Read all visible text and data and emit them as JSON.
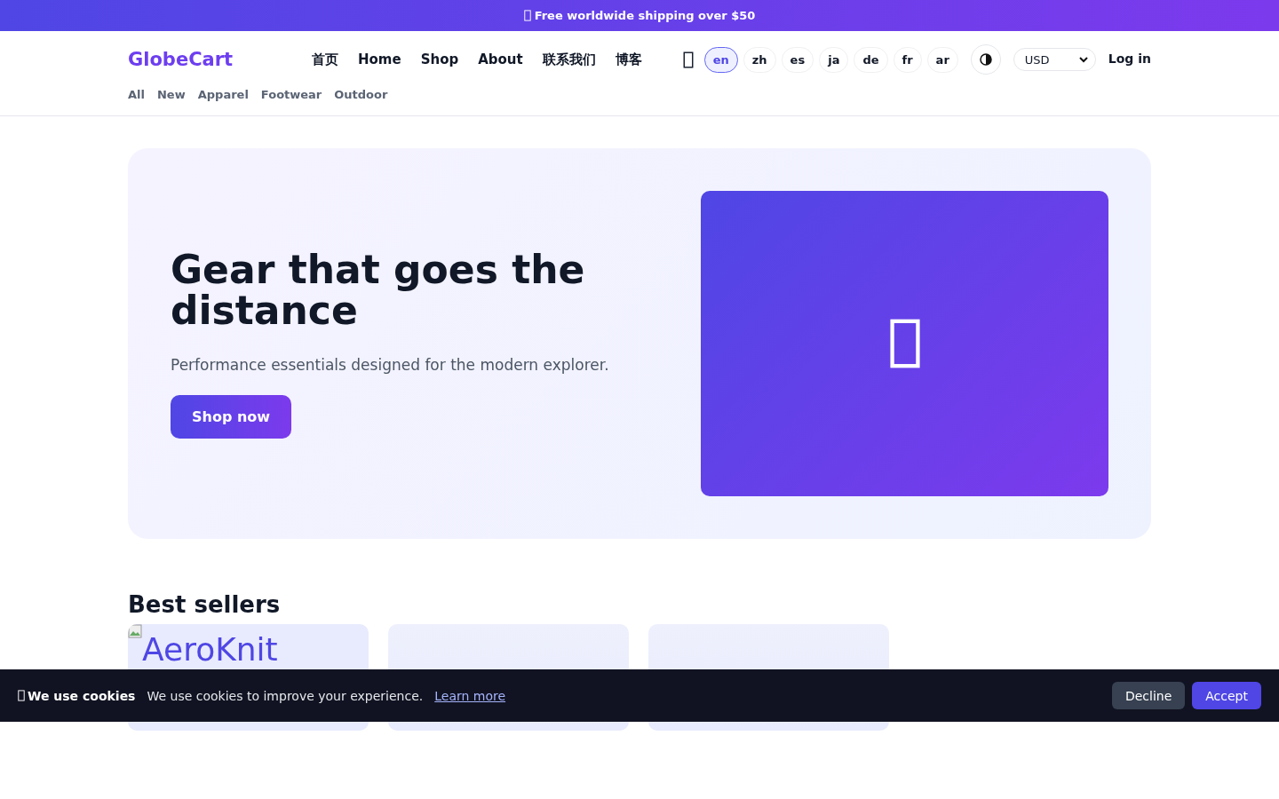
{
  "announcement": {
    "text": "Free worldwide shipping over $50"
  },
  "header": {
    "logo": "GlobeCart",
    "nav": [
      {
        "label": "首页"
      },
      {
        "label": "Home"
      },
      {
        "label": "Shop"
      },
      {
        "label": "About"
      },
      {
        "label": "联系我们"
      },
      {
        "label": "博客"
      }
    ],
    "languages": [
      {
        "label": "en",
        "selected": true
      },
      {
        "label": "zh",
        "selected": false
      },
      {
        "label": "es",
        "selected": false
      },
      {
        "label": "ja",
        "selected": false
      },
      {
        "label": "de",
        "selected": false
      },
      {
        "label": "fr",
        "selected": false
      },
      {
        "label": "ar",
        "selected": false
      }
    ],
    "currency": "USD",
    "login": "Log in",
    "categories": [
      {
        "label": "All"
      },
      {
        "label": "New"
      },
      {
        "label": "Apparel"
      },
      {
        "label": "Footwear"
      },
      {
        "label": "Outdoor"
      }
    ]
  },
  "hero": {
    "title": "Gear that goes the distance",
    "subtitle": "Performance essentials designed for the modern explorer.",
    "button": "Shop now"
  },
  "best_sellers": {
    "title": "Best sellers",
    "products": [
      {
        "kind": "broken-image",
        "alt": "AeroKnit"
      },
      {
        "kind": "placeholder"
      },
      {
        "kind": "placeholder"
      }
    ]
  },
  "cookie_banner": {
    "title": "We use cookies",
    "text": "We use cookies to improve your experience.",
    "link": "Learn more",
    "buttons": [
      {
        "label": "Decline",
        "kind": "secondary"
      },
      {
        "label": "Accept",
        "kind": "primary"
      }
    ]
  }
}
